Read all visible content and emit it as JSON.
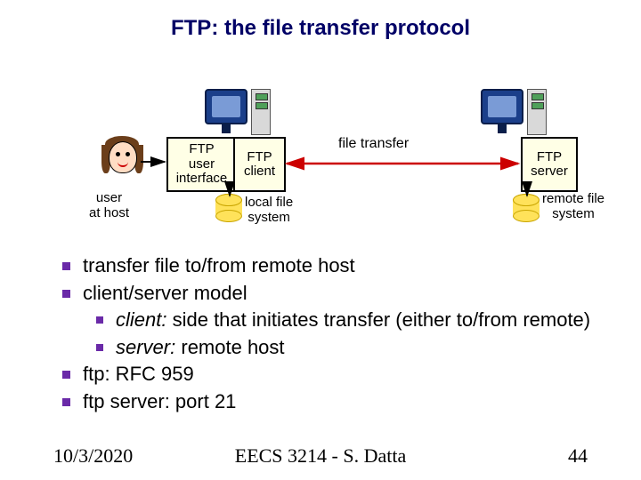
{
  "title": "FTP: the file transfer protocol",
  "diagram": {
    "box_user_interface": "FTP\nuser\ninterface",
    "box_client": "FTP\nclient",
    "box_server": "FTP\nserver",
    "transfer_label": "file transfer",
    "user_at_host": "user\nat host",
    "local_fs": "local file\nsystem",
    "remote_fs": "remote file\nsystem"
  },
  "bullets": {
    "b1": "transfer file to/from remote host",
    "b2": "client/server model",
    "b2a_em": "client:",
    "b2a_rest": " side that initiates transfer (either to/from remote)",
    "b2b_em": "server:",
    "b2b_rest": " remote host",
    "b3": "ftp: RFC 959",
    "b4": "ftp server: port 21"
  },
  "footer": {
    "date": "10/3/2020",
    "center": "EECS 3214 - S. Datta",
    "page": "44"
  }
}
